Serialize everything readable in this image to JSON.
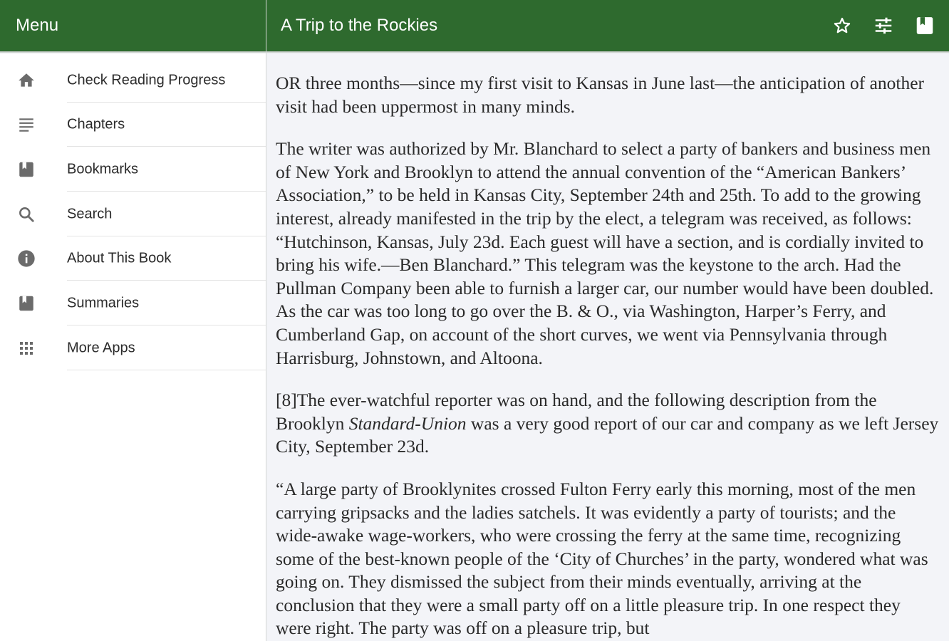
{
  "menu_bar": {
    "title": "Menu"
  },
  "title_bar": {
    "title": "A Trip to the Rockies",
    "actions": [
      "star-outline-icon",
      "tune-sliders-icon",
      "bookmark-book-icon"
    ]
  },
  "sidebar": {
    "items": [
      {
        "label": "Check Reading Progress",
        "icon": "home-icon"
      },
      {
        "label": "Chapters",
        "icon": "list-lines-icon"
      },
      {
        "label": "Bookmarks",
        "icon": "book-icon"
      },
      {
        "label": "Search",
        "icon": "search-icon"
      },
      {
        "label": "About This Book",
        "icon": "info-icon"
      },
      {
        "label": "Summaries",
        "icon": "book-icon"
      },
      {
        "label": "More Apps",
        "icon": "apps-grid-icon"
      }
    ]
  },
  "content": {
    "p1": "OR three months—since my first visit to Kansas in June last—the anticipation of another visit had been uppermost in many minds.",
    "p2": "The writer was authorized by Mr. Blanchard to select a party of bankers and business men of New York and Brooklyn to attend the annual convention of the “American Bankers’ Association,” to be held in Kansas City, September 24th and 25th. To add to the growing interest, already manifested in the trip by the elect, a telegram was received, as follows: “Hutchinson, Kansas, July 23d. Each guest will have a section, and is cordially invited to bring his wife.—Ben Blanchard.” This telegram was the keystone to the arch. Had the Pullman Company been able to furnish a larger car, our number would have been doubled. As the car was too long to go over the B. & O., via Washington, Harper’s Ferry, and Cumberland Gap, on account of the short curves, we went via Pennsylvania through Harrisburg, Johnstown, and Altoona.",
    "p3_before": "[8]The ever-watchful reporter was on hand, and the following description from the Brooklyn ",
    "p3_italic": "Standard-Union",
    "p3_after": " was a very good report of our car and company as we left Jersey City, September 23d.",
    "p4": "“A large party of Brooklynites crossed Fulton Ferry early this morning, most of the men carrying gripsacks and the ladies satchels. It was evidently a party of tourists; and the wide-awake wage-workers, who were crossing the ferry at the same time, recognizing some of the best-known people of the ‘City of Churches’ in the party, wondered what was going on. They dismissed the subject from their minds eventually, arriving at the conclusion that they were a small party off on a little pleasure trip. In one respect they were right. The party was off on a pleasure trip, but"
  },
  "colors": {
    "app_bar": "#2e6a2e",
    "background": "#f3f4f8",
    "sidebar": "#ffffff",
    "icon": "#6b6b6b"
  }
}
